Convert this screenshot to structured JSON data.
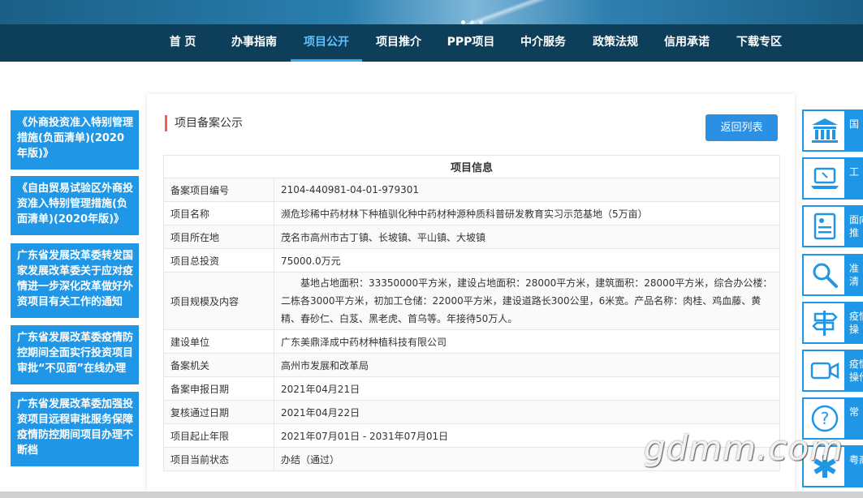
{
  "nav": {
    "items": [
      "首 页",
      "办事指南",
      "项目公开",
      "项目推介",
      "PPP项目",
      "中介服务",
      "政策法规",
      "信用承诺",
      "下载专区"
    ],
    "active": "项目公开"
  },
  "left_links": [
    "《外商投资准入特别管理措施(负面清单)(2020年版)》",
    "《自由贸易试验区外商投资准入特别管理措施(负面清单)(2020年版)》",
    "广东省发展改革委转发国家发展改革委关于应对疫情进一步深化改革做好外资项目有关工作的通知",
    "广东省发展改革委疫情防控期间全面实行投资项目审批“不见面”在线办理",
    "广东省发展改革委加强投资项目远程审批服务保障疫情防控期间项目办理不断档"
  ],
  "main": {
    "title": "项目备案公示",
    "back_button": "返回列表",
    "table_header": "项目信息",
    "rows": [
      {
        "label": "备案项目编号",
        "value": "2104-440981-04-01-979301"
      },
      {
        "label": "项目名称",
        "value": "濒危珍稀中药材林下种植驯化种中药材种源种质科普研发教育实习示范基地（5万亩）"
      },
      {
        "label": "项目所在地",
        "value": "茂名市高州市古丁镇、长坡镇、平山镇、大坡镇"
      },
      {
        "label": "项目总投资",
        "value": "75000.0万元"
      },
      {
        "label": "项目规模及内容",
        "value": "基地占地面积：33350000平方米，建设占地面积：28000平方米，建筑面积：28000平方米，综合办公楼：二栋各3000平方米，初加工仓储：22000平方米，建设道路长300公里，6米宽。产品名称：肉桂、鸡血藤、黄精、春砂仁、白芨、黑老虎、首乌等。年接待50万人。"
      },
      {
        "label": "建设单位",
        "value": "广东美鼎泽成中药材种植科技有限公司"
      },
      {
        "label": "备案机关",
        "value": "高州市发展和改革局"
      },
      {
        "label": "备案申报日期",
        "value": "2021年04月21日"
      },
      {
        "label": "复核通过日期",
        "value": "2021年04月22日"
      },
      {
        "label": "项目起止年限",
        "value": "2021年07月01日 - 2031年07月01日"
      },
      {
        "label": "项目当前状态",
        "value": "办结（通过）"
      }
    ]
  },
  "right_items": [
    {
      "icon": "bank-icon",
      "label": "国"
    },
    {
      "icon": "laptop-icon",
      "label": "工"
    },
    {
      "icon": "certificate-icon",
      "label": "面向\n推"
    },
    {
      "icon": "magnifier-icon",
      "label": "准\n清"
    },
    {
      "icon": "signpost-icon",
      "label": "疫情\n操"
    },
    {
      "icon": "video-camera-icon",
      "label": "疫情\n操作"
    },
    {
      "icon": "question-icon",
      "label": "常"
    },
    {
      "icon": "medical-star-icon",
      "label": "粤商"
    }
  ],
  "watermark": "gdmm.com",
  "colors": {
    "nav_bg": "#0e3f5a",
    "accent": "#1f97e6",
    "active_nav": "#5fc3ff",
    "title_bar": "#f0604d"
  }
}
